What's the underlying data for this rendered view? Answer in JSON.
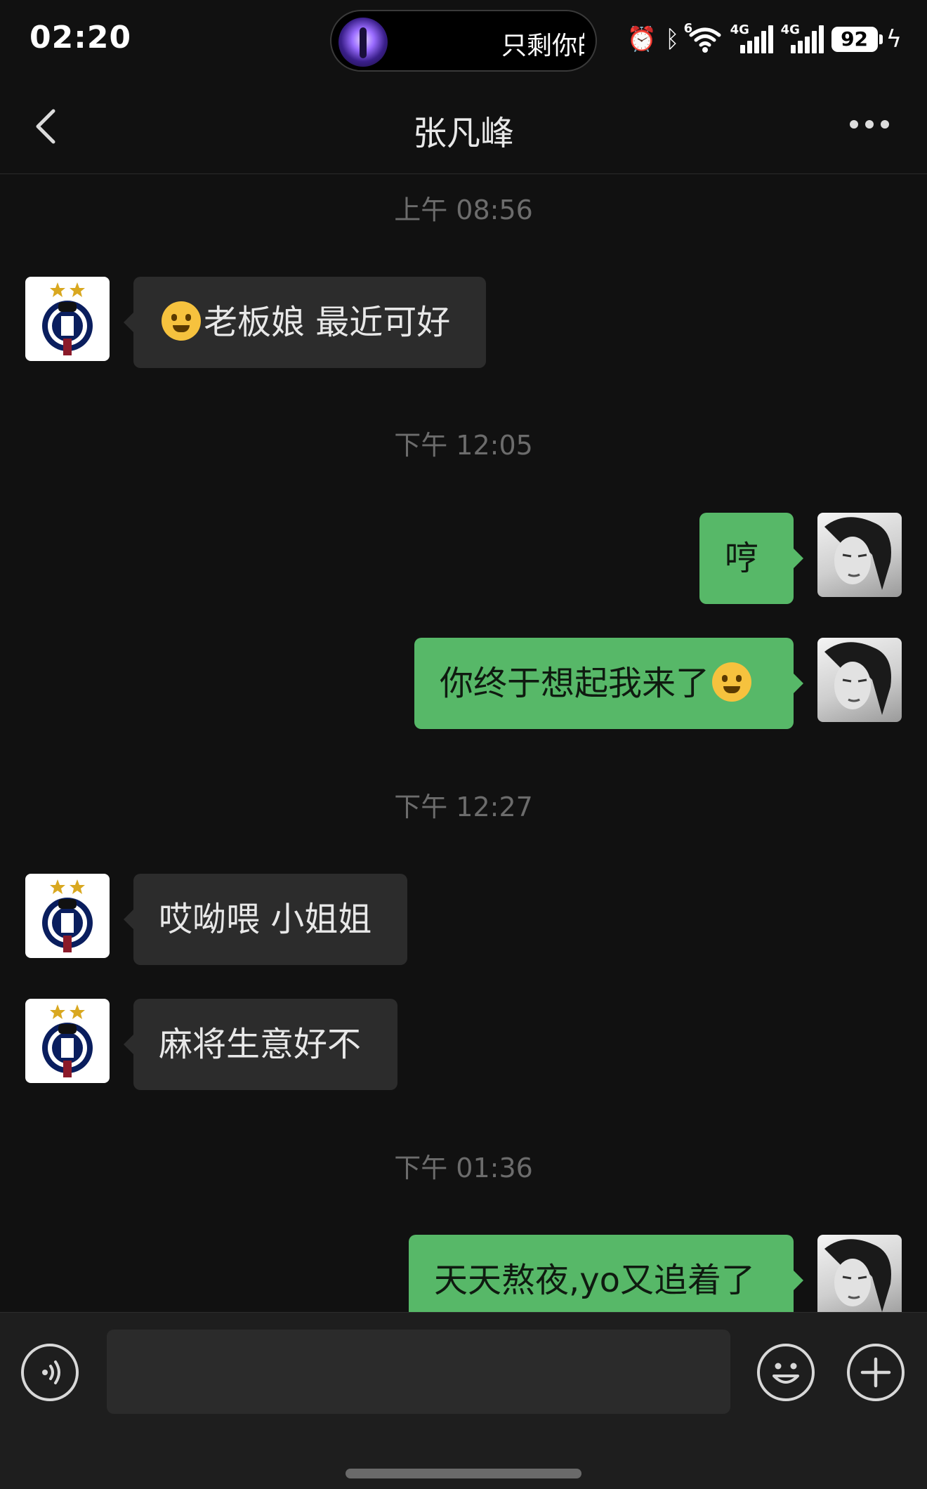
{
  "status_bar": {
    "time": "02:20",
    "now_playing": "只剩你的",
    "network_1": "4G",
    "network_2": "4G",
    "wifi_tag": "6",
    "battery": "92"
  },
  "header": {
    "title": "张凡峰"
  },
  "messages": [
    {
      "type": "timestamp",
      "text": "上午 08:56"
    },
    {
      "type": "incoming",
      "text": "老板娘 最近可好",
      "emoji": "peeking-face-emoji"
    },
    {
      "type": "timestamp",
      "text": "下午 12:05"
    },
    {
      "type": "outgoing",
      "text": "哼"
    },
    {
      "type": "outgoing",
      "text": "你终于想起我来了",
      "emoji": "crying-laughing-emoji"
    },
    {
      "type": "timestamp",
      "text": "下午 12:27"
    },
    {
      "type": "incoming",
      "text": "哎呦喂 小姐姐"
    },
    {
      "type": "incoming",
      "text": "麻将生意好不"
    },
    {
      "type": "timestamp",
      "text": "下午 01:36"
    },
    {
      "type": "outgoing",
      "text": "天天熬夜,yo又追着了"
    }
  ],
  "colors": {
    "background": "#111111",
    "incoming_bubble": "#2c2c2c",
    "outgoing_bubble": "#57b868",
    "timestamp_text": "#6c6c6c"
  },
  "icons": {
    "back": "chevron-left-icon",
    "more": "more-dots-icon",
    "voice": "voice-icon",
    "emoji": "smiley-icon",
    "plus": "plus-icon"
  }
}
